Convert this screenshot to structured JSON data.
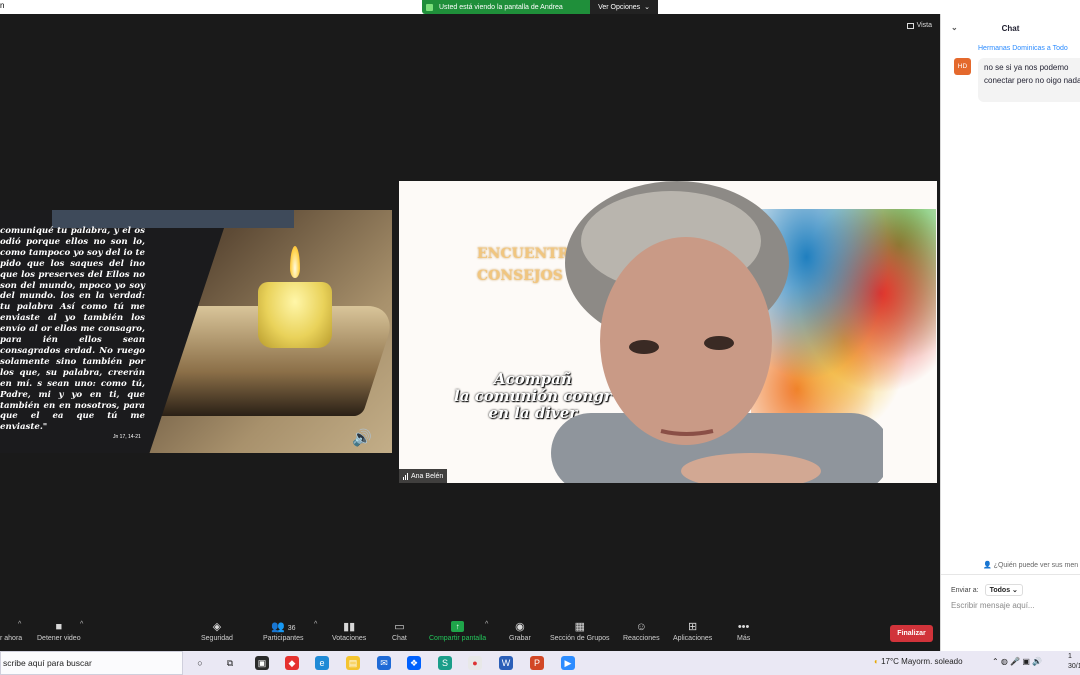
{
  "window": {
    "title_fragment": "n"
  },
  "share_banner": {
    "status": "Usted está viendo la pantalla de Andrea",
    "options": "Ver Opciones"
  },
  "view_button": "Vista",
  "left_tile": {
    "verse": "comuniqué tu palabra, y el os odió porque ellos no son lo, como tampoco yo soy del io te pido que los saques del ino que los preserves del Ellos no son del mundo, mpoco yo soy del mundo. los en la verdad: tu palabra Así como tú me enviaste al yo también los envío al or ellos me consagro, para ién ellos sean consagrados erdad. No ruego solamente sino también por los que, su palabra, creerán en mí. s sean uno: como tú, Padre, mi y yo en ti, que también en en nosotros, para que el ea que tú me enviaste.\"",
    "reference": "Jn 17, 14-21"
  },
  "right_tile": {
    "title_line1": "ENCUENTRO",
    "title_line2": "CONSEJOS 2",
    "subtitle_line1": "Acompañ",
    "subtitle_line2": "la comunión congr",
    "subtitle_line3": "en la diver",
    "participant_name": "Ana Belén"
  },
  "toolbar": {
    "unmute_label": "r ahora",
    "video_label": "Detener video",
    "security_label": "Seguridad",
    "participants_label": "Participantes",
    "participants_count": "36",
    "polls_label": "Votaciones",
    "chat_label": "Chat",
    "share_label": "Compartir pantalla",
    "record_label": "Grabar",
    "breakout_label": "Sección de Grupos",
    "reactions_label": "Reacciones",
    "apps_label": "Aplicaciones",
    "more_label": "Más",
    "end_label": "Finalizar"
  },
  "chat": {
    "title": "Chat",
    "message_from": "Hermanas Dominicas a Todo",
    "avatar_initials": "HD",
    "message_text": "no se si ya nos podemo conectar pero no oigo nada",
    "who_can_see": "¿Quién puede ver sus men",
    "send_to_label": "Enviar a:",
    "send_to_value": "Todos",
    "input_placeholder": "Escribir mensaje aquí..."
  },
  "taskbar": {
    "search_placeholder": "scribe aquí para buscar",
    "weather": "17°C  Mayorm. soleado",
    "time": "1",
    "date": "30/1"
  },
  "colors": {
    "share_green": "#1f8f3a",
    "end_red": "#d1333a",
    "chat_blue": "#2d8cff",
    "avatar_orange": "#e4692d"
  }
}
